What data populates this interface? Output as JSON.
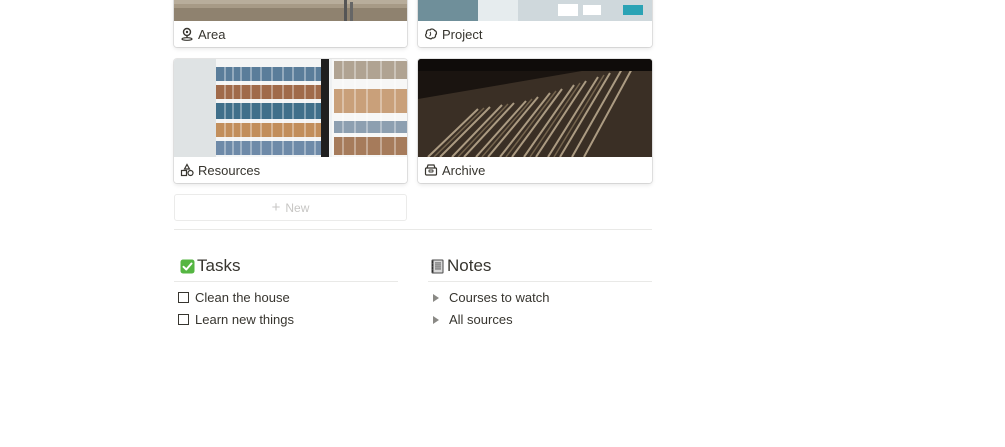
{
  "gallery": {
    "cards": [
      {
        "label": "Area",
        "icon": "map-pin-icon"
      },
      {
        "label": "Project",
        "icon": "brain-icon"
      },
      {
        "label": "Resources",
        "icon": "shapes-icon"
      },
      {
        "label": "Archive",
        "icon": "archive-box-icon"
      }
    ],
    "new_label": "New"
  },
  "tasks": {
    "title": "Tasks",
    "icon": "check-mark-button-icon",
    "accent": "#55b642",
    "items": [
      "Clean the house",
      "Learn new things"
    ]
  },
  "notes": {
    "title": "Notes",
    "icon": "notebook-icon",
    "items": [
      "Courses to watch",
      "All sources"
    ]
  }
}
